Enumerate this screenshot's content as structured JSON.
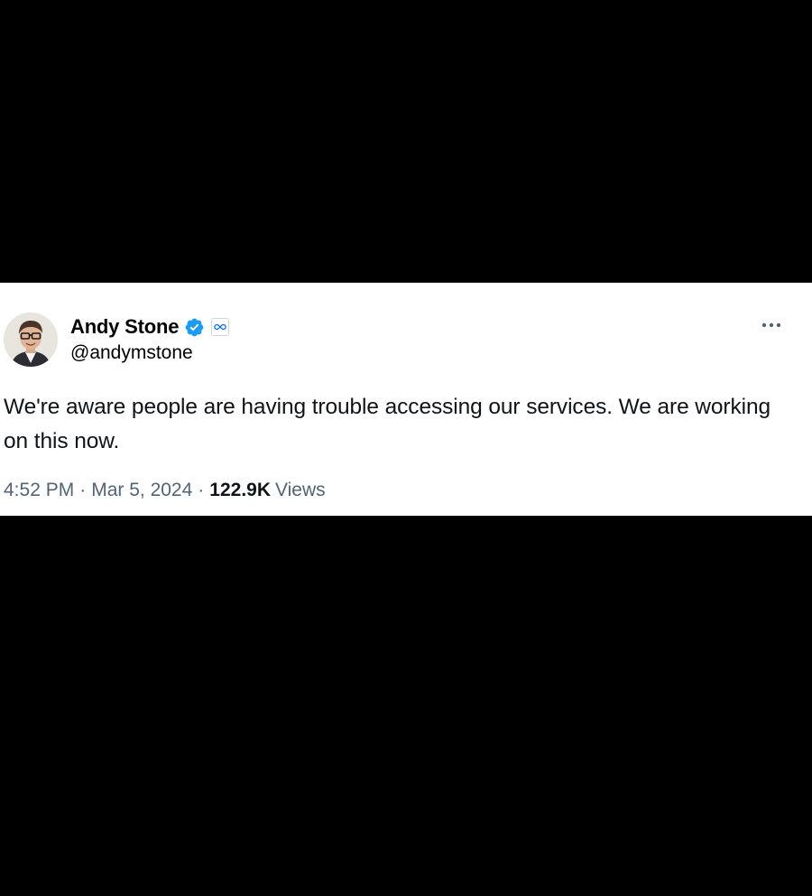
{
  "tweet": {
    "author": {
      "display_name": "Andy Stone",
      "handle": "@andymstone",
      "verified_icon": "verified-badge-icon",
      "affiliate_icon": "meta-infinity-icon",
      "avatar_icon": "profile-photo"
    },
    "text": "We're aware people are having trouble accessing our services. We are working on this now.",
    "time": "4:52 PM",
    "separator": "·",
    "date": "Mar 5, 2024",
    "views_count": "122.9K",
    "views_label": "Views",
    "more_icon": "more-options-icon"
  },
  "colors": {
    "background": "#000000",
    "card": "#ffffff",
    "text_primary": "#0f1419",
    "text_secondary": "#536471",
    "verified_blue": "#1d9bf0",
    "meta_blue": "#0668e1"
  }
}
